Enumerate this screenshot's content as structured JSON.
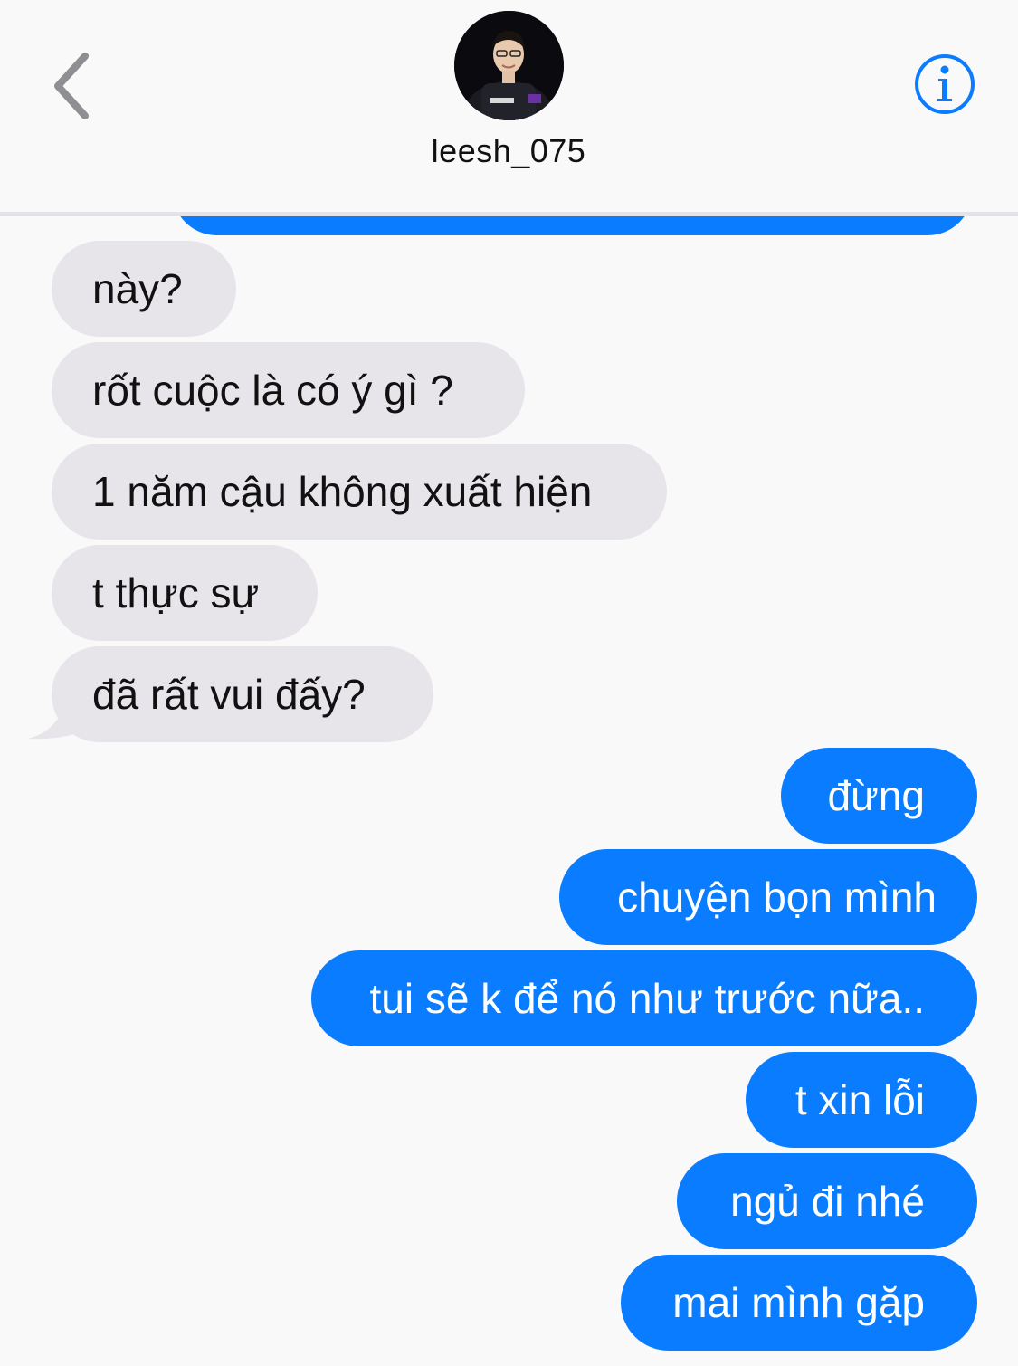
{
  "header": {
    "contact_name": "leesh_075",
    "back_icon": "chevron-left-icon",
    "info_icon": "info-icon",
    "accent_color": "#0a7cff"
  },
  "messages": {
    "incoming": [
      "này?",
      "rốt cuộc là có ý gì ?",
      "1 năm cậu không xuất hiện",
      "t thực sự",
      "đã rất vui đấy?"
    ],
    "outgoing": [
      "đừng",
      "chuyện bọn mình",
      "tui sẽ k để nó như trước nữa..",
      "t xin lỗi",
      "ngủ đi nhé",
      "mai mình gặp"
    ]
  },
  "colors": {
    "incoming_bubble": "#e7e5ea",
    "outgoing_bubble": "#0a7cff",
    "background": "#f9f9f9"
  }
}
